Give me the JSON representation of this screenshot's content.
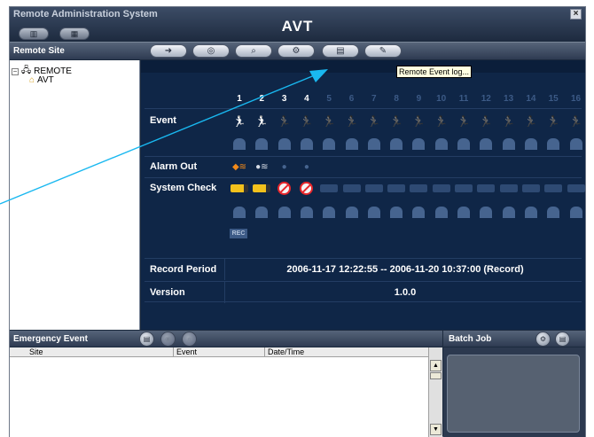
{
  "window": {
    "title": "Remote Administration System",
    "app_name": "AVT",
    "close_label": "×",
    "top_buttons": [
      {
        "name": "layout-single-button",
        "glyph": "▥"
      },
      {
        "name": "layout-grid-button",
        "glyph": "▦"
      }
    ]
  },
  "sidebar": {
    "header": "Remote Site",
    "tree": [
      {
        "label": "REMOTE",
        "expander": "−",
        "icon": "network-icon",
        "level": 0
      },
      {
        "label": "AVT",
        "icon": "site-icon",
        "level": 1
      }
    ]
  },
  "toolbar": {
    "buttons": [
      {
        "name": "connect-button",
        "glyph": "➜"
      },
      {
        "name": "watch-button",
        "glyph": "◎"
      },
      {
        "name": "search-button",
        "glyph": "⌕"
      },
      {
        "name": "setup-button",
        "glyph": "⚙"
      },
      {
        "name": "remote-event-log-button",
        "glyph": "▤"
      },
      {
        "name": "remote-control-button",
        "glyph": "✎"
      }
    ]
  },
  "tooltip": "Remote Event log...",
  "status_panel": {
    "channels": [
      "1",
      "2",
      "3",
      "4",
      "5",
      "6",
      "7",
      "8",
      "9",
      "10",
      "11",
      "12",
      "13",
      "14",
      "15",
      "16"
    ],
    "active_channels": 4,
    "labels": {
      "event": "Event",
      "alarm_out": "Alarm Out",
      "system_check": "System Check",
      "rec": "REC"
    },
    "system_check": [
      "ok",
      "ok",
      "no-signal",
      "no-signal",
      "off",
      "off",
      "off",
      "off",
      "off",
      "off",
      "off",
      "off",
      "off",
      "off",
      "off",
      "off"
    ],
    "alarm_out": [
      "triggered",
      "active",
      "off",
      "off"
    ],
    "record_period_label": "Record Period",
    "record_period": "2006-11-17 12:22:55 -- 2006-11-20 10:37:00 (Record)",
    "version_label": "Version",
    "version": "1.0.0"
  },
  "emergency": {
    "title": "Emergency Event",
    "columns": [
      "Site",
      "Event",
      "Date/Time"
    ],
    "buttons": [
      {
        "name": "emergency-list-button",
        "glyph": "▤",
        "enabled": true
      },
      {
        "name": "emergency-ack-button",
        "glyph": "◉",
        "enabled": false
      },
      {
        "name": "emergency-search-button",
        "glyph": "⌕",
        "enabled": false
      }
    ]
  },
  "batch_job": {
    "title": "Batch Job",
    "buttons": [
      {
        "name": "batch-run-button",
        "glyph": "⚙"
      },
      {
        "name": "batch-list-button",
        "glyph": "▤"
      }
    ]
  },
  "colors": {
    "panel_bg": "#0f2647",
    "pointer": "#19b8f0",
    "camera_ok": "#f2c11c",
    "no_signal": "#e8262b"
  }
}
